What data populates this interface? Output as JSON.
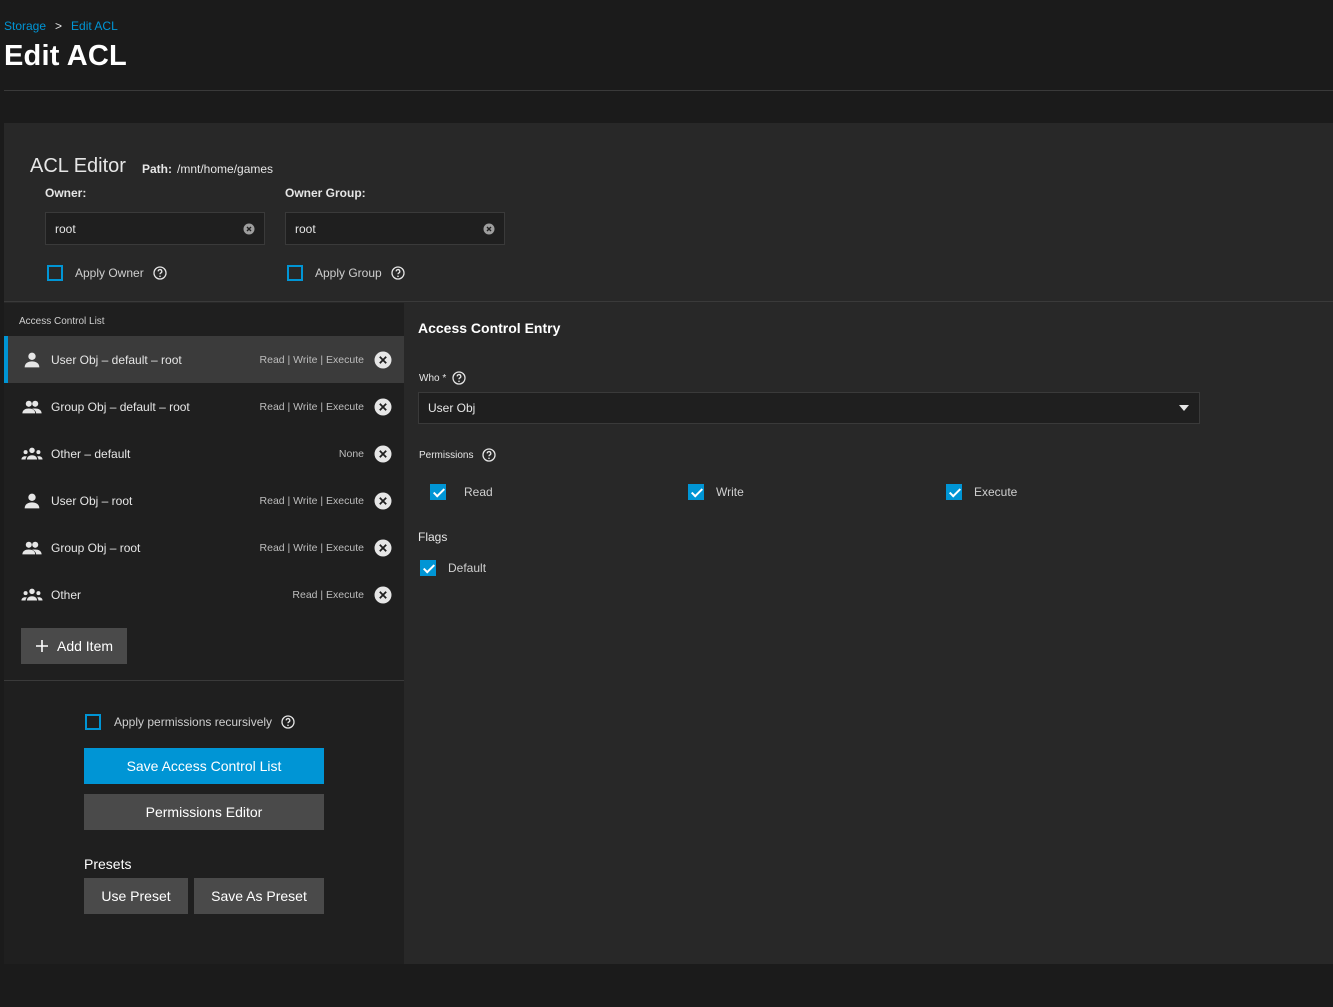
{
  "breadcrumb": {
    "parent": "Storage",
    "separator": ">",
    "current": "Edit ACL"
  },
  "page_title": "Edit ACL",
  "editor": {
    "title": "ACL Editor",
    "path_label": "Path:",
    "path_value": "/mnt/home/games",
    "owner_label": "Owner:",
    "owner_value": "root",
    "owner_group_label": "Owner Group:",
    "owner_group_value": "root",
    "apply_owner_label": "Apply Owner",
    "apply_group_label": "Apply Group",
    "apply_owner_checked": false,
    "apply_group_checked": false
  },
  "acl_list": {
    "label": "Access Control List",
    "items": [
      {
        "name": "User Obj – default – root",
        "perms": "Read | Write | Execute",
        "icon": "user-icon"
      },
      {
        "name": "Group Obj – default – root",
        "perms": "Read | Write | Execute",
        "icon": "group-icon"
      },
      {
        "name": "Other – default",
        "perms": "None",
        "icon": "other-users-icon"
      },
      {
        "name": "User Obj – root",
        "perms": "Read | Write | Execute",
        "icon": "user-icon"
      },
      {
        "name": "Group Obj – root",
        "perms": "Read | Write | Execute",
        "icon": "group-icon"
      },
      {
        "name": "Other",
        "perms": "Read | Execute",
        "icon": "other-users-icon"
      }
    ],
    "selected_index": 0,
    "add_item_label": "Add Item"
  },
  "actions": {
    "recursive_label": "Apply permissions recursively",
    "recursive_checked": false,
    "save_label": "Save Access Control List",
    "permissions_editor_label": "Permissions Editor",
    "presets_label": "Presets",
    "use_preset_label": "Use Preset",
    "save_as_preset_label": "Save As Preset"
  },
  "entry": {
    "title": "Access Control Entry",
    "who_label": "Who *",
    "who_value": "User Obj",
    "permissions_label": "Permissions",
    "read_label": "Read",
    "write_label": "Write",
    "execute_label": "Execute",
    "read_checked": true,
    "write_checked": true,
    "execute_checked": true,
    "flags_label": "Flags",
    "default_label": "Default",
    "default_checked": true
  },
  "colors": {
    "accent": "#0095d5",
    "background": "#1b1b1b",
    "card": "#282828",
    "panel": "#1f1f1f"
  }
}
